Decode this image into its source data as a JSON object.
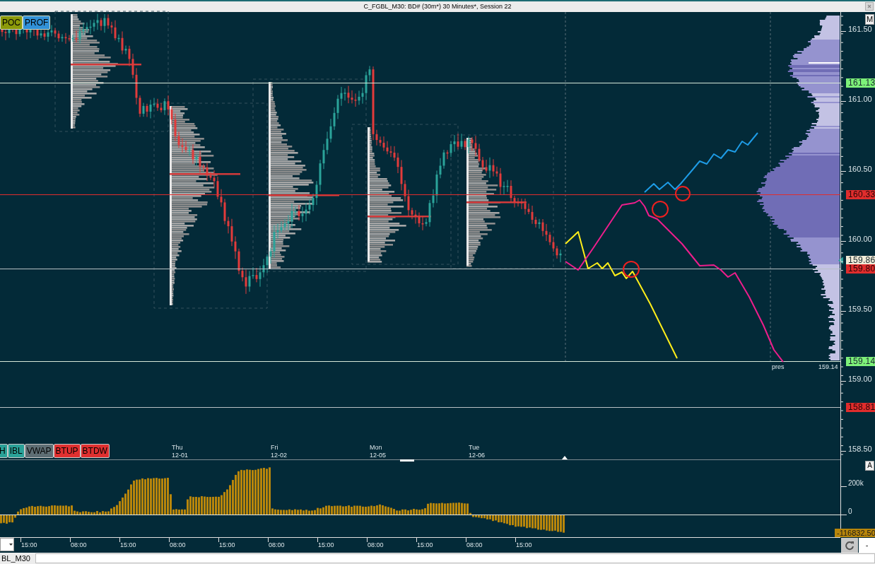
{
  "window": {
    "title": "C_FGBL_M30: BD# (30m*) 30 Minutes*, Session 22"
  },
  "profile_buttons": [
    {
      "label": "POC",
      "color": "#8c9a0a"
    },
    {
      "label": "PROF",
      "color": "#3191d8"
    }
  ],
  "m_button": {
    "label": "M"
  },
  "price_axis": {
    "ticks": [
      "161.50",
      "161.00",
      "160.50",
      "160.00",
      "159.50",
      "159.00",
      "158.50"
    ]
  },
  "price_levels": [
    {
      "label": "161.13",
      "color": "#7ef27a"
    },
    {
      "label": "160.33",
      "color": "#e02d2d"
    },
    {
      "label": "159.86",
      "color": "#f1ecd8"
    },
    {
      "label": "159.80",
      "color": "#e02d2d"
    },
    {
      "label": "159.14",
      "color": "#7ef27a"
    },
    {
      "label": "158.81",
      "color": "#e02d2d"
    }
  ],
  "range_annotation": {
    "label": "pres",
    "value": "159.14"
  },
  "indicator_buttons": [
    {
      "label": "H",
      "color": "#2aa198"
    },
    {
      "label": "IBL",
      "color": "#2aa198"
    },
    {
      "label": "VWAP",
      "color": "#5e6e74"
    },
    {
      "label": "BTUP",
      "color": "#e03030"
    },
    {
      "label": "BTDW",
      "color": "#e03030"
    }
  ],
  "day_labels": [
    {
      "day": "Thu",
      "date": "12-01"
    },
    {
      "day": "Fri",
      "date": "12-02"
    },
    {
      "day": "Mon",
      "date": "12-05"
    },
    {
      "day": "Tue",
      "date": "12-06"
    }
  ],
  "indicator": {
    "button": "A",
    "ticks": [
      "200k",
      "0"
    ],
    "value_label": "-116832.50"
  },
  "time_axis": {
    "labels": [
      "15:00",
      "08:00",
      "15:00",
      "08:00",
      "15:00",
      "08:00",
      "15:00",
      "08:00",
      "15:00",
      "08:00",
      "15:00"
    ]
  },
  "bottom_bar": {
    "tab": "BL_M30",
    "step_box": "-"
  }
}
